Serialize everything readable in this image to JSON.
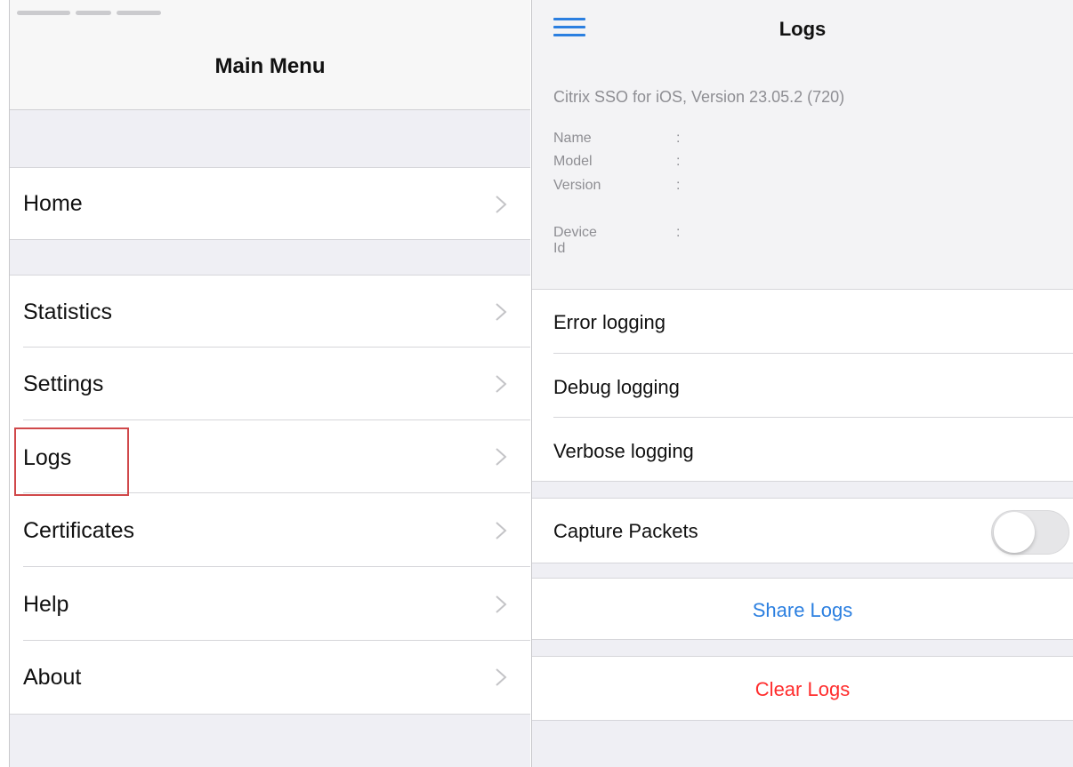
{
  "left_panel": {
    "title": "Main Menu",
    "items": [
      {
        "label": "Home"
      },
      {
        "label": "Statistics"
      },
      {
        "label": "Settings"
      },
      {
        "label": "Logs"
      },
      {
        "label": "Certificates"
      },
      {
        "label": "Help"
      },
      {
        "label": "About"
      }
    ],
    "chevron_icon": "chevron-right-icon",
    "highlight_color": "#d0484a"
  },
  "right_panel": {
    "title": "Logs",
    "menu_icon": "hamburger-menu-icon",
    "version_text": "Citrix SSO for iOS, Version 23.05.2 (720)",
    "device_info": [
      {
        "key": "Name",
        "sep": ":"
      },
      {
        "key": "Model",
        "sep": ":"
      },
      {
        "key": "Version",
        "sep": ":"
      },
      {
        "key": "Device Id",
        "sep": ":"
      }
    ],
    "logging_options": [
      {
        "label": "Error logging"
      },
      {
        "label": "Debug logging"
      },
      {
        "label": "Verbose logging"
      }
    ],
    "capture_packets": {
      "label": "Capture Packets",
      "enabled": false
    },
    "share_logs": {
      "label": "Share Logs",
      "color": "#2b7fe0"
    },
    "clear_logs": {
      "label": "Clear Logs",
      "color": "#ff2d2d"
    }
  }
}
